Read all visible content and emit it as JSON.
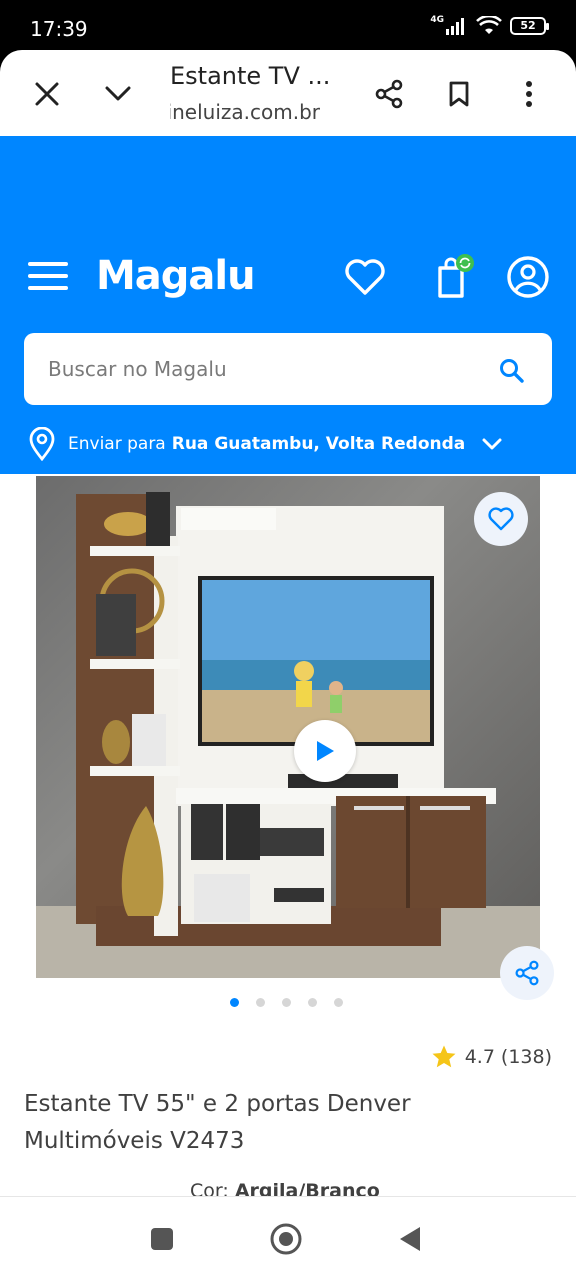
{
  "status_bar": {
    "time": "17:39",
    "network": "4G",
    "battery": "52"
  },
  "browser": {
    "title": "Estante TV ...",
    "url": "magazineluiza.com.br"
  },
  "header": {
    "logo": "Magalu",
    "cart_badge_icon": "refresh-icon",
    "search_placeholder": "Buscar no Magalu",
    "ship_prefix": "Enviar para",
    "ship_address": "Rua Guatambu, Volta Redonda"
  },
  "carousel": {
    "total": 5,
    "active": 1
  },
  "product": {
    "rating": "4.7",
    "reviews": "(138)",
    "title": "Estante TV 55\" e 2 portas Denver Multimóveis V2473",
    "color_label": "Cor:",
    "color_value": "Argila/Branco"
  },
  "colors": {
    "brand_blue": "#0086ff",
    "star": "#f5c518"
  }
}
